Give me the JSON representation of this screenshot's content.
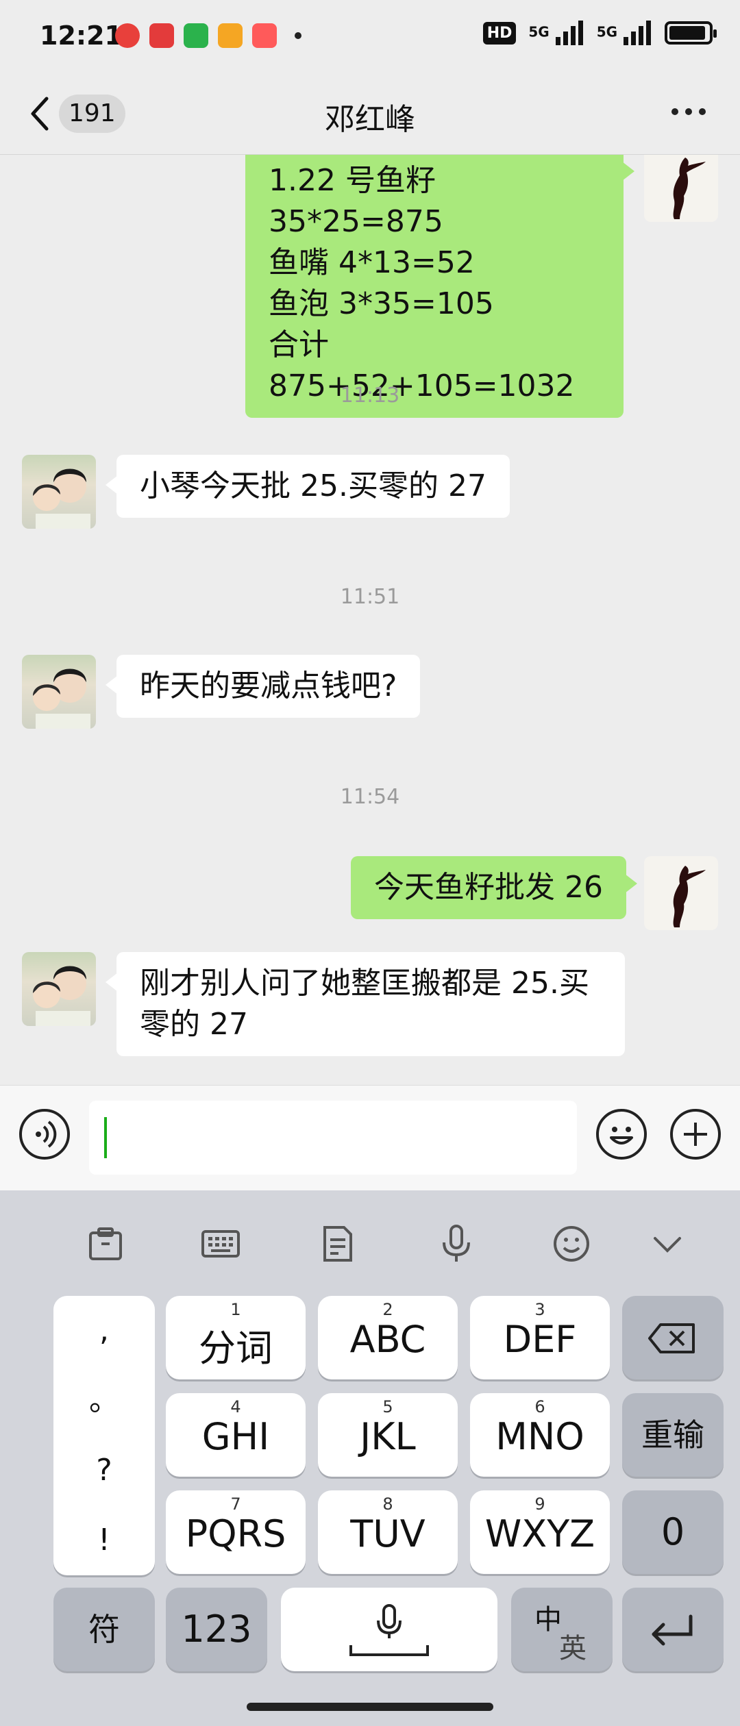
{
  "status_bar": {
    "time": "12:21",
    "hd": "HD",
    "signal_1": "5G",
    "signal_2": "5G",
    "app_icon_colors": [
      "#e8403b",
      "#e33b3b",
      "#2bb24c",
      "#f5a623",
      "#ff5a5a"
    ]
  },
  "header": {
    "back_badge": "191",
    "title": "邓红峰",
    "more_icon": "ellipsis-icon"
  },
  "messages": [
    {
      "side": "right",
      "type": "text",
      "lines": [
        "1.22 号鱼籽 35*25=875",
        "鱼嘴 4*13=52",
        "鱼泡 3*35=105",
        "合计 875+52+105=1032"
      ]
    },
    {
      "type": "time",
      "text": "11:13"
    },
    {
      "side": "left",
      "type": "text",
      "text": "小琴今天批 25.买零的 27"
    },
    {
      "type": "time",
      "text": "11:51"
    },
    {
      "side": "left",
      "type": "text",
      "text": "昨天的要减点钱吧?"
    },
    {
      "type": "time",
      "text": "11:54"
    },
    {
      "side": "right",
      "type": "text",
      "text": "今天鱼籽批发 26"
    },
    {
      "side": "left",
      "type": "text",
      "lines": [
        "刚才别人问了她整匡搬都是 25.买",
        "零的 27"
      ]
    }
  ],
  "input_bar": {
    "voice_icon": "voice-icon",
    "emoji_icon": "emoji-icon",
    "plus_icon": "plus-icon"
  },
  "keyboard": {
    "toolbar_icons": [
      "clipboard-icon",
      "keyboard-icon",
      "document-icon",
      "microphone-icon",
      "emoji-icon",
      "chevron-down-icon"
    ],
    "punctuation": [
      ",",
      "。",
      "?",
      "!"
    ],
    "keys": {
      "k1": {
        "num": "1",
        "label": "分词"
      },
      "k2": {
        "num": "2",
        "label": "ABC"
      },
      "k3": {
        "num": "3",
        "label": "DEF"
      },
      "k4": {
        "num": "4",
        "label": "GHI"
      },
      "k5": {
        "num": "5",
        "label": "JKL"
      },
      "k6": {
        "num": "6",
        "label": "MNO"
      },
      "k7": {
        "num": "7",
        "label": "PQRS"
      },
      "k8": {
        "num": "8",
        "label": "TUV"
      },
      "k9": {
        "num": "9",
        "label": "WXYZ"
      },
      "reenter": "重输",
      "zero": "0",
      "symbol": "符",
      "num123": "123",
      "lang_zh": "中",
      "lang_en": "英"
    }
  },
  "colors": {
    "sent_bubble": "#a9e97c",
    "received_bubble": "#ffffff",
    "background": "#ededed",
    "keyboard_bg": "#d3d5db"
  }
}
